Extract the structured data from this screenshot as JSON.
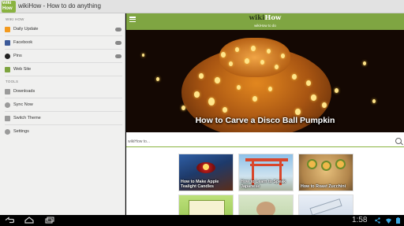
{
  "app": {
    "logo_text": "wiki How",
    "title": "wikiHow - How to do anything"
  },
  "drawer": {
    "section1": "WIKI HOW",
    "items": [
      {
        "label": "Daily Update",
        "icon": "rss-icon",
        "color": "#f39a1e",
        "has_badge": true
      },
      {
        "label": "Facebook",
        "icon": "facebook-icon",
        "color": "#3b5998",
        "has_badge": true
      },
      {
        "label": "Pins",
        "icon": "pinterest-icon",
        "color": "#222222",
        "has_badge": true
      },
      {
        "label": "Web Site",
        "icon": "website-icon",
        "color": "#7ea43f",
        "has_badge": false
      }
    ],
    "section2": "TOOLS",
    "tools": [
      {
        "label": "Downloads",
        "icon": "download-icon"
      },
      {
        "label": "Sync Now",
        "icon": "sync-icon"
      },
      {
        "label": "Switch Theme",
        "icon": "theme-icon"
      },
      {
        "label": "Settings",
        "icon": "gear-icon"
      }
    ]
  },
  "header": {
    "brand_wiki": "wiki",
    "brand_how": "How",
    "subtitle": "wikiHow to do"
  },
  "hero": {
    "title": "How to Carve a Disco Ball Pumpkin",
    "page_count": 10,
    "active_page": 0
  },
  "search": {
    "placeholder": "wikiHow to..."
  },
  "cards": [
    {
      "caption": "How to Make Apple Tealight Candles"
    },
    {
      "caption": "How to Learn to Speak Japanese"
    },
    {
      "caption": "How to Roast Zucchini"
    },
    {
      "caption": ""
    },
    {
      "caption": ""
    },
    {
      "caption": ""
    }
  ],
  "status": {
    "time": "1:58"
  },
  "colors": {
    "accent": "#7fa542",
    "drawer_bg": "#f0f0ef"
  }
}
